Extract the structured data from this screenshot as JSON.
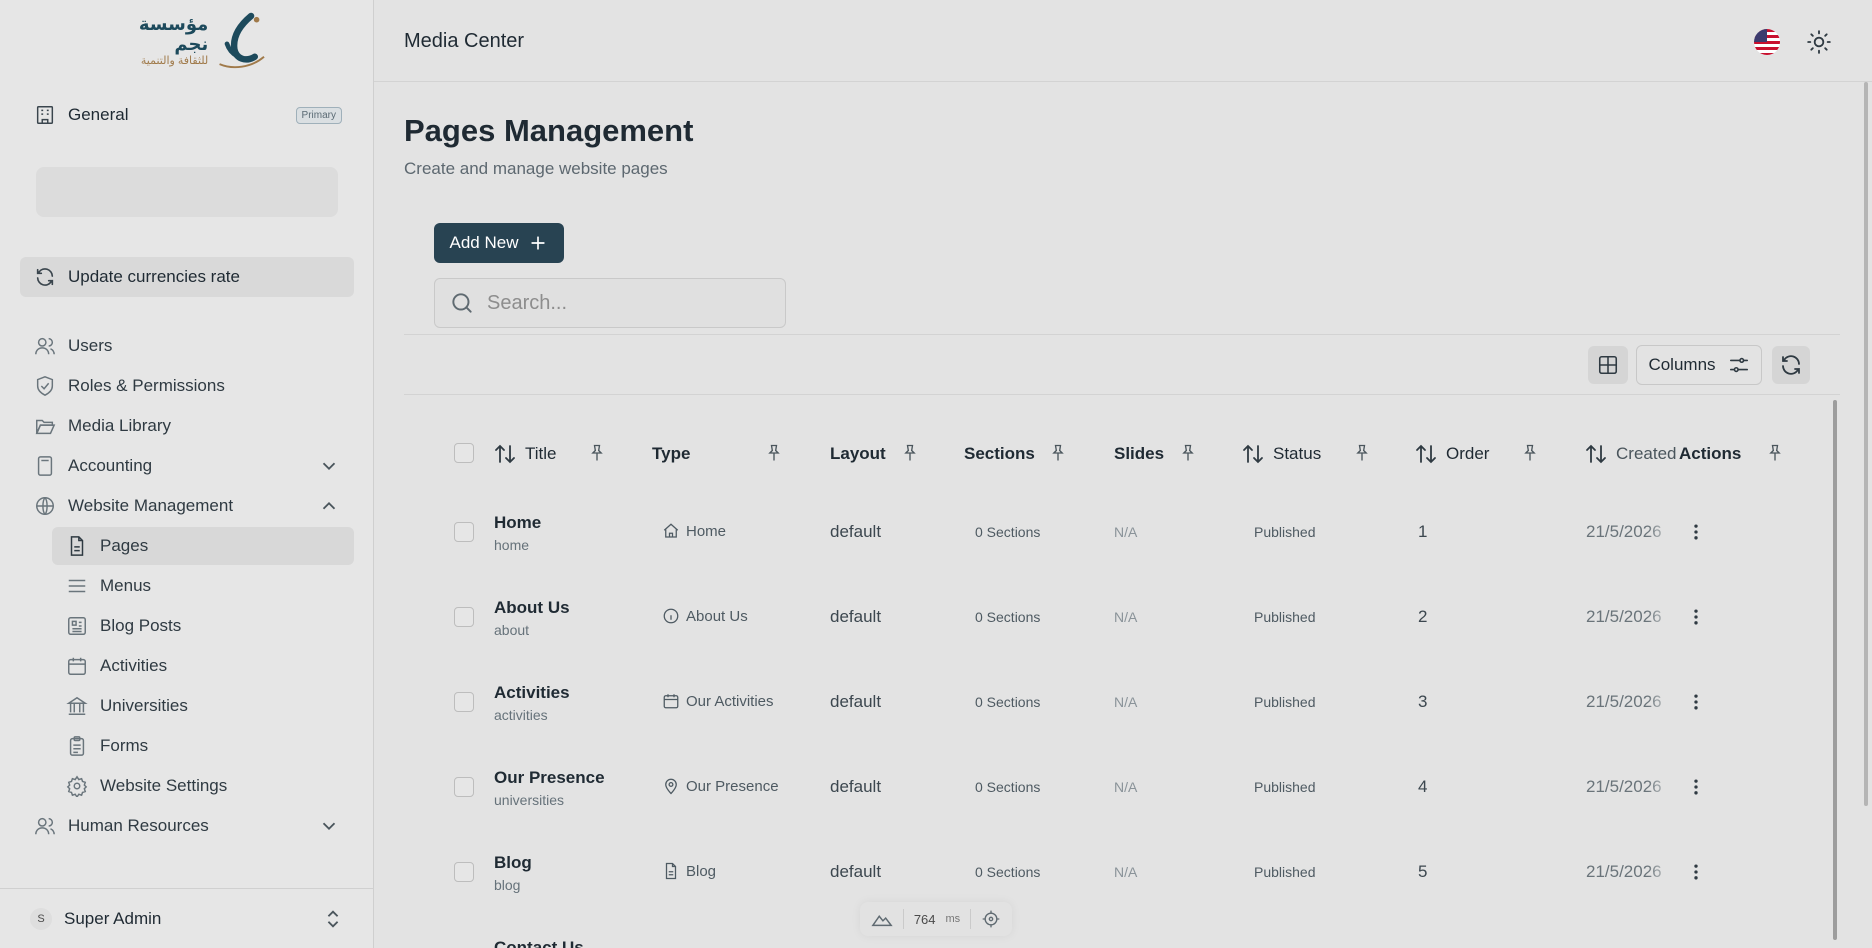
{
  "sidebar": {
    "logo": {
      "line1": "مؤسسة نجم",
      "line2": "للثقافة والتنمية"
    },
    "org": {
      "label": "General",
      "badge": "Primary"
    },
    "update_rates": "Update currencies rate",
    "items": [
      {
        "label": "Users",
        "icon": "users-icon"
      },
      {
        "label": "Roles & Permissions",
        "icon": "shield-check-icon"
      },
      {
        "label": "Media Library",
        "icon": "folder-open-icon"
      },
      {
        "label": "Accounting",
        "icon": "calculator-icon"
      },
      {
        "label": "Website Management",
        "icon": "globe-icon"
      },
      {
        "label": "Human Resources",
        "icon": "users-icon"
      }
    ],
    "website_sub": [
      {
        "label": "Pages",
        "icon": "file-text-icon"
      },
      {
        "label": "Menus",
        "icon": "menu-icon"
      },
      {
        "label": "Blog Posts",
        "icon": "newspaper-icon"
      },
      {
        "label": "Activities",
        "icon": "calendar-icon"
      },
      {
        "label": "Universities",
        "icon": "landmark-icon"
      },
      {
        "label": "Forms",
        "icon": "clipboard-icon"
      },
      {
        "label": "Website Settings",
        "icon": "settings-icon"
      }
    ],
    "user": {
      "initial": "S",
      "name": "Super Admin"
    }
  },
  "header": {
    "title": "Media Center"
  },
  "page": {
    "title": "Pages Management",
    "subtitle": "Create and manage website pages",
    "add_button": "Add New",
    "search_placeholder": "Search...",
    "columns_button": "Columns"
  },
  "table": {
    "columns": [
      "Title",
      "Type",
      "Layout",
      "Sections",
      "Slides",
      "Status",
      "Order",
      "Created",
      "Actions"
    ],
    "rows": [
      {
        "title": "Home",
        "slug": "home",
        "type": "Home",
        "type_icon": "home-icon",
        "layout": "default",
        "sections": "0 Sections",
        "slides": "N/A",
        "status": "Published",
        "order": "1",
        "created": "21/5/2026"
      },
      {
        "title": "About Us",
        "slug": "about",
        "type": "About Us",
        "type_icon": "info-icon",
        "layout": "default",
        "sections": "0 Sections",
        "slides": "N/A",
        "status": "Published",
        "order": "2",
        "created": "21/5/2026"
      },
      {
        "title": "Activities",
        "slug": "activities",
        "type": "Our Activities",
        "type_icon": "calendar-icon",
        "layout": "default",
        "sections": "0 Sections",
        "slides": "N/A",
        "status": "Published",
        "order": "3",
        "created": "21/5/2026"
      },
      {
        "title": "Our Presence",
        "slug": "universities",
        "type": "Our Presence",
        "type_icon": "map-pin-icon",
        "layout": "default",
        "sections": "0 Sections",
        "slides": "N/A",
        "status": "Published",
        "order": "4",
        "created": "21/5/2026"
      },
      {
        "title": "Blog",
        "slug": "blog",
        "type": "Blog",
        "type_icon": "file-text-icon",
        "layout": "default",
        "sections": "0 Sections",
        "slides": "N/A",
        "status": "Published",
        "order": "5",
        "created": "21/5/2026"
      }
    ],
    "partial_row_title": "Contact Us"
  },
  "perf": {
    "value": "764",
    "unit": "ms"
  },
  "colors": {
    "primary": "#284352",
    "background": "#e3e3e3"
  }
}
